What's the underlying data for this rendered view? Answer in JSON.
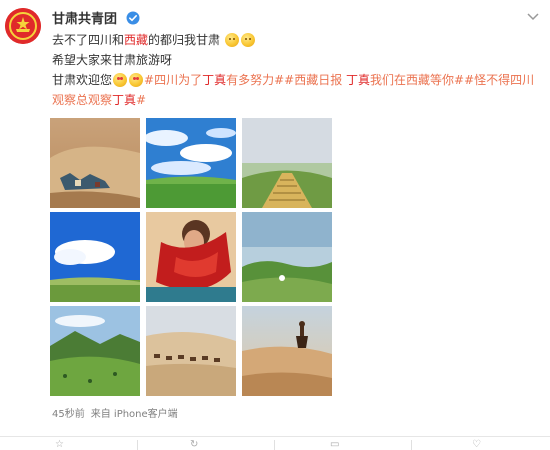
{
  "post": {
    "username": "甘肃共青团",
    "line1": {
      "t1": "去不了四川和",
      "t2": "西藏",
      "t3": "的都归我甘肃"
    },
    "line2": "希望大家来甘肃旅游呀",
    "line3": {
      "t1": "甘肃欢迎您",
      "tag1a": "#四川为了",
      "tag1b": "丁真",
      "tag1c": "有多努力#",
      "tag2": "#西藏日报 ",
      "tag2b": "丁真",
      "tag2c": "我们在西藏等你#",
      "tag3a": "#怪不得四川观察总",
      "tag3b": "观察",
      "tag3c": "丁真",
      "tag3d": "#"
    },
    "timestamp": "45秒前",
    "source": "来自 iPhone客户端"
  },
  "icons": {
    "avatar": "communist-youth-league-emblem-icon",
    "verified": "verified-check-icon",
    "menu": "chevron-down-icon",
    "emoji1": "pleading-face-icon",
    "emoji2": "heart-eyes-icon"
  },
  "images": [
    {
      "alt": "desert with tents"
    },
    {
      "alt": "blue sky with clouds over grassland"
    },
    {
      "alt": "stairway on green hill"
    },
    {
      "alt": "blue sky over green meadow"
    },
    {
      "alt": "woman with red scarf"
    },
    {
      "alt": "green hills with mist"
    },
    {
      "alt": "mountain grassland"
    },
    {
      "alt": "camel caravan on sand dunes"
    },
    {
      "alt": "person on sand dunes"
    }
  ],
  "colors": {
    "accent_red": "#e02a2a",
    "tag_orange": "#eb7350",
    "meta_gray": "#808080"
  }
}
